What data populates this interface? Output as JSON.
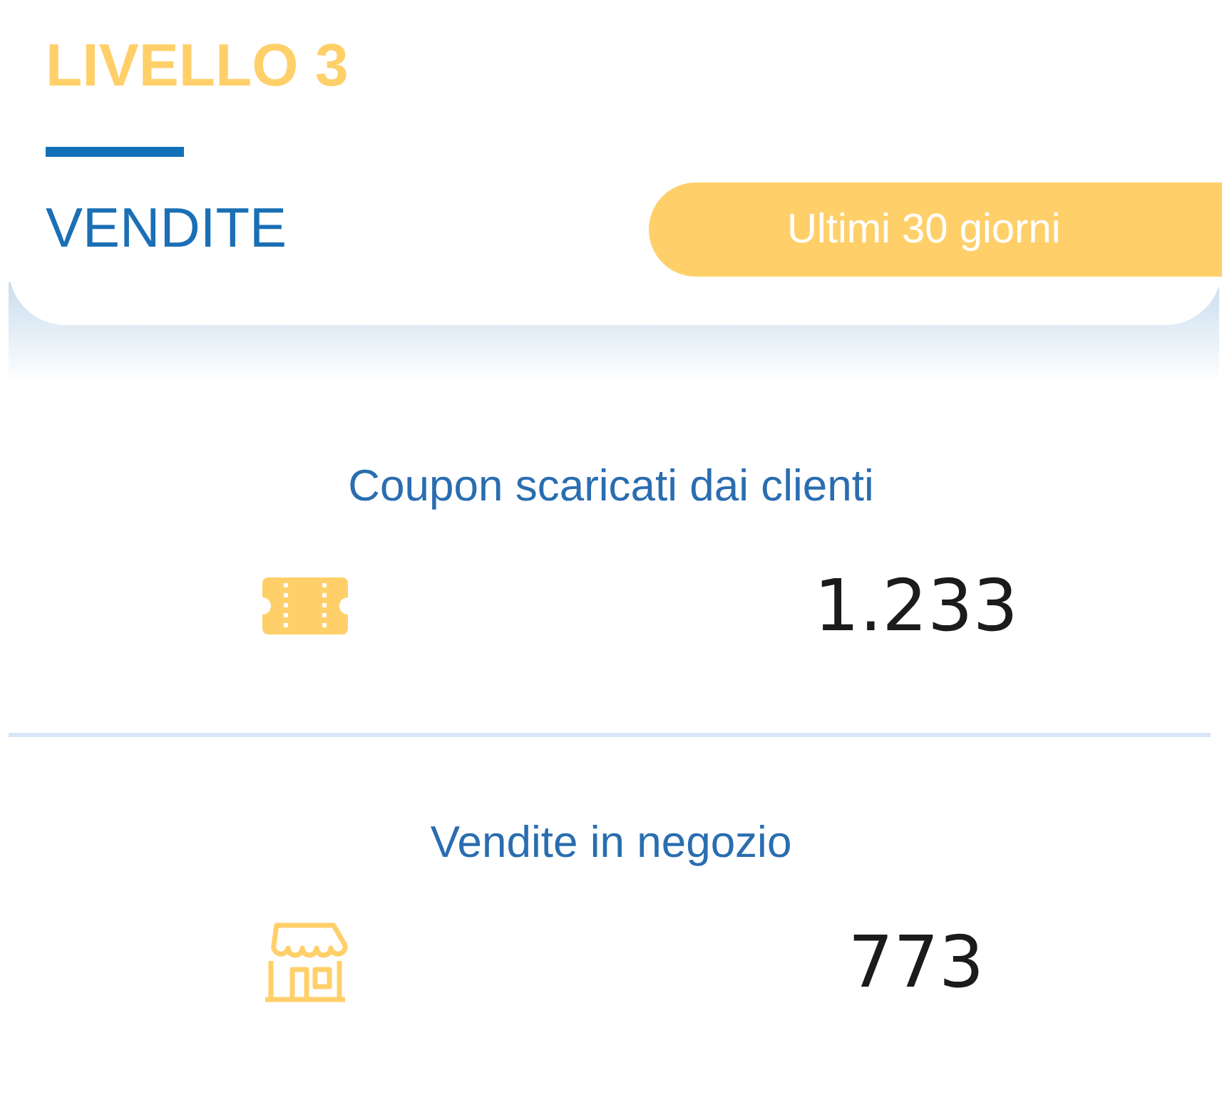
{
  "header": {
    "level_title": "LIVELLO 3",
    "section": "VENDITE",
    "period_button": "Ultimi 30 giorni"
  },
  "stats": [
    {
      "label": "Coupon scaricati dai clienti",
      "kind": "ticket",
      "value": "1.233"
    },
    {
      "label": "Vendite in negozio",
      "kind": "store",
      "value": "773"
    }
  ]
}
